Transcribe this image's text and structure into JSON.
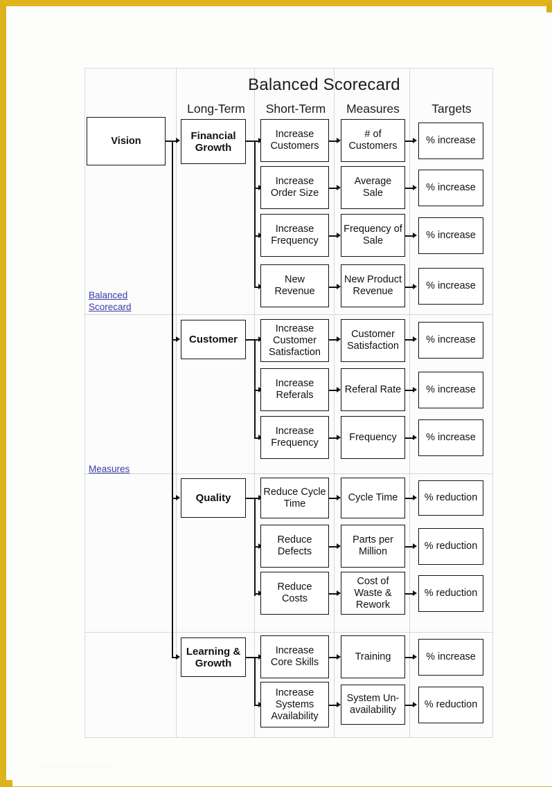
{
  "page": {
    "frame_color": "#e0b31c",
    "background": "#fefefd",
    "watermark": "www.templates-office.com"
  },
  "scorecard": {
    "title": "Balanced Scorecard",
    "column_headers": [
      {
        "id": "vision",
        "label": ""
      },
      {
        "id": "long-term",
        "label": "Long-Term"
      },
      {
        "id": "short-term",
        "label": "Short-Term"
      },
      {
        "id": "measures",
        "label": "Measures"
      },
      {
        "id": "targets",
        "label": "Targets"
      }
    ],
    "vision": {
      "label": "Vision"
    },
    "sidebar_links": [
      {
        "id": "balanced-scorecard",
        "label": "Balanced Scorecard"
      },
      {
        "id": "measures",
        "label": "Measures"
      }
    ],
    "perspectives": [
      {
        "id": "financial-growth",
        "label": "Financial Growth",
        "rows": [
          {
            "objective": "Increase Customers",
            "measure": "# of Customers",
            "target": "% increase"
          },
          {
            "objective": "Increase Order Size",
            "measure": "Average Sale",
            "target": "% increase"
          },
          {
            "objective": "Increase Frequency",
            "measure": "Frequency of Sale",
            "target": "% increase"
          },
          {
            "objective": "New Revenue",
            "measure": "New Product Revenue",
            "target": "% increase"
          }
        ]
      },
      {
        "id": "customer",
        "label": "Customer",
        "rows": [
          {
            "objective": "Increase Customer Satisfaction",
            "measure": "Customer Satisfaction",
            "target": "% increase"
          },
          {
            "objective": "Increase Referals",
            "measure": "Referal Rate",
            "target": "% increase"
          },
          {
            "objective": "Increase Frequency",
            "measure": "Frequency",
            "target": "% increase"
          }
        ]
      },
      {
        "id": "quality",
        "label": "Quality",
        "rows": [
          {
            "objective": "Reduce Cycle Time",
            "measure": "Cycle Time",
            "target": "% reduction"
          },
          {
            "objective": "Reduce Defects",
            "measure": "Parts per Million",
            "target": "% reduction"
          },
          {
            "objective": "Reduce Costs",
            "measure": "Cost of Waste & Rework",
            "target": "% reduction"
          }
        ]
      },
      {
        "id": "learning-growth",
        "label": "Learning & Growth",
        "rows": [
          {
            "objective": "Increase Core Skills",
            "measure": "Training",
            "target": "% increase"
          },
          {
            "objective": "Increase Systems Availability",
            "measure": "System Un-availability",
            "target": "% reduction"
          }
        ]
      }
    ]
  }
}
